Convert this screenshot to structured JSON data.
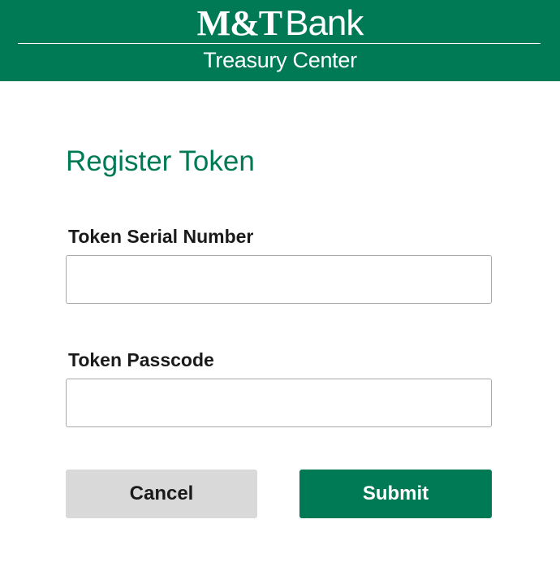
{
  "header": {
    "brand_mt": "M&T",
    "brand_bank": "Bank",
    "subtitle": "Treasury Center",
    "background_color": "#007A55"
  },
  "form": {
    "title": "Register Token",
    "fields": [
      {
        "label": "Token Serial Number",
        "value": "",
        "placeholder": ""
      },
      {
        "label": "Token Passcode",
        "value": "",
        "placeholder": ""
      }
    ],
    "cancel_label": "Cancel",
    "submit_label": "Submit",
    "accent_color": "#007A55",
    "cancel_color": "#D9D9D9"
  }
}
